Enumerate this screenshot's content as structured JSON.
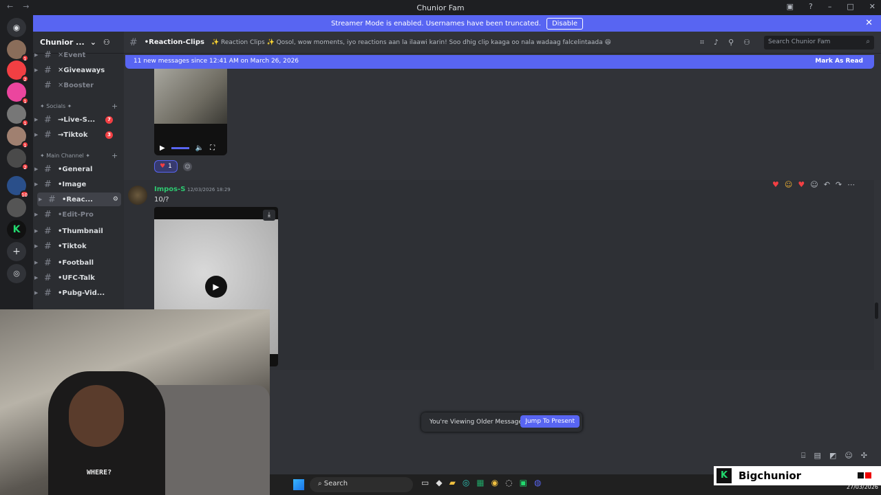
{
  "window": {
    "title": "Chunior Fam"
  },
  "streamer": {
    "text": "Streamer Mode is enabled. Usernames have been truncated.",
    "disable_label": "Disable"
  },
  "guild": {
    "name": "Chunior ..."
  },
  "channels": {
    "items": [
      {
        "label": "✕Event",
        "state": "muted"
      },
      {
        "label": "✕Giveaways",
        "state": "normal"
      },
      {
        "label": "✕Booster",
        "state": "muted"
      },
      {
        "label": "→Live-S...",
        "state": "normal",
        "count": "7"
      },
      {
        "label": "→Tiktok",
        "state": "normal",
        "count": "3"
      },
      {
        "label": "•General",
        "state": "normal"
      },
      {
        "label": "•Image",
        "state": "normal"
      },
      {
        "label": "•Reac...",
        "state": "active"
      },
      {
        "label": "•Edit-Pro",
        "state": "muted"
      },
      {
        "label": "•Thumbnail",
        "state": "normal"
      },
      {
        "label": "•Tiktok",
        "state": "normal"
      },
      {
        "label": "•Football",
        "state": "normal"
      },
      {
        "label": "•UFC-Talk",
        "state": "normal"
      },
      {
        "label": "•Pubg-Vid...",
        "state": "normal"
      }
    ],
    "categories": [
      "✦ Socials ✦",
      "✦ Main Channel ✦"
    ]
  },
  "server_badges": [
    "1",
    "2",
    "1",
    "1",
    "1",
    "2",
    "10"
  ],
  "header": {
    "channel_name": "•Reaction-Clips",
    "topic": "✨ Reaction Clips ✨ Qosol, wow moments, iyo reactions aan la ilaawi karin! Soo dhig clip kaaga oo nala wadaag falcelintaada 😆",
    "search_placeholder": "Search Chunior Fam"
  },
  "newbar": {
    "text": "11 new messages since 12:41 AM on March 26, 2026",
    "mark_label": "Mark As Read"
  },
  "reaction": {
    "count": "1"
  },
  "message": {
    "author": "Impos-S",
    "timestamp": "12/03/2026 18:29",
    "text": "10/?"
  },
  "older": {
    "text": "You're Viewing Older Messages",
    "jump_label": "Jump To Present"
  },
  "webcam": {
    "shirt_text": "WHERE?"
  },
  "taskbar": {
    "search_label": "Search",
    "date": "27/03/2026"
  },
  "brand": {
    "name": "Bigchunior",
    "colors": {
      "accent": "#5865f2",
      "danger": "#f23f43",
      "author": "#2dc770"
    }
  }
}
